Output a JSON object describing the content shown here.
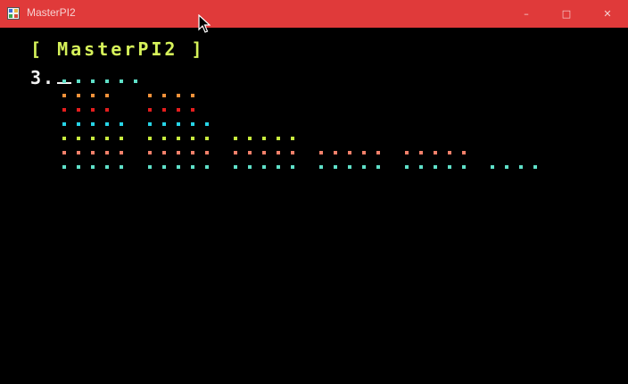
{
  "window": {
    "title": "MasterPI2",
    "controls": {
      "minimize": "–",
      "maximize": "□",
      "close": "✕"
    },
    "titlebar_color": "#e03a3a"
  },
  "console": {
    "heading": "[ MasterPI2 ]",
    "prompt": "3."
  },
  "digit_rows": [
    {
      "color": "#5fe0c8",
      "groups": [
        6
      ]
    },
    {
      "color": "#f5923a",
      "groups": [
        4,
        4
      ]
    },
    {
      "color": "#e41e1e",
      "groups": [
        4,
        4
      ]
    },
    {
      "color": "#27d4e6",
      "groups": [
        5,
        5
      ]
    },
    {
      "color": "#c8ec3e",
      "groups": [
        5,
        5,
        5
      ]
    },
    {
      "color": "#f4806a",
      "groups": [
        5,
        5,
        5,
        5,
        5
      ]
    },
    {
      "color": "#5fe0c8",
      "groups": [
        5,
        5,
        5,
        5,
        5,
        4
      ]
    }
  ],
  "icons": {
    "app": "app-window-icon",
    "cursor": "mouse-pointer-icon"
  }
}
